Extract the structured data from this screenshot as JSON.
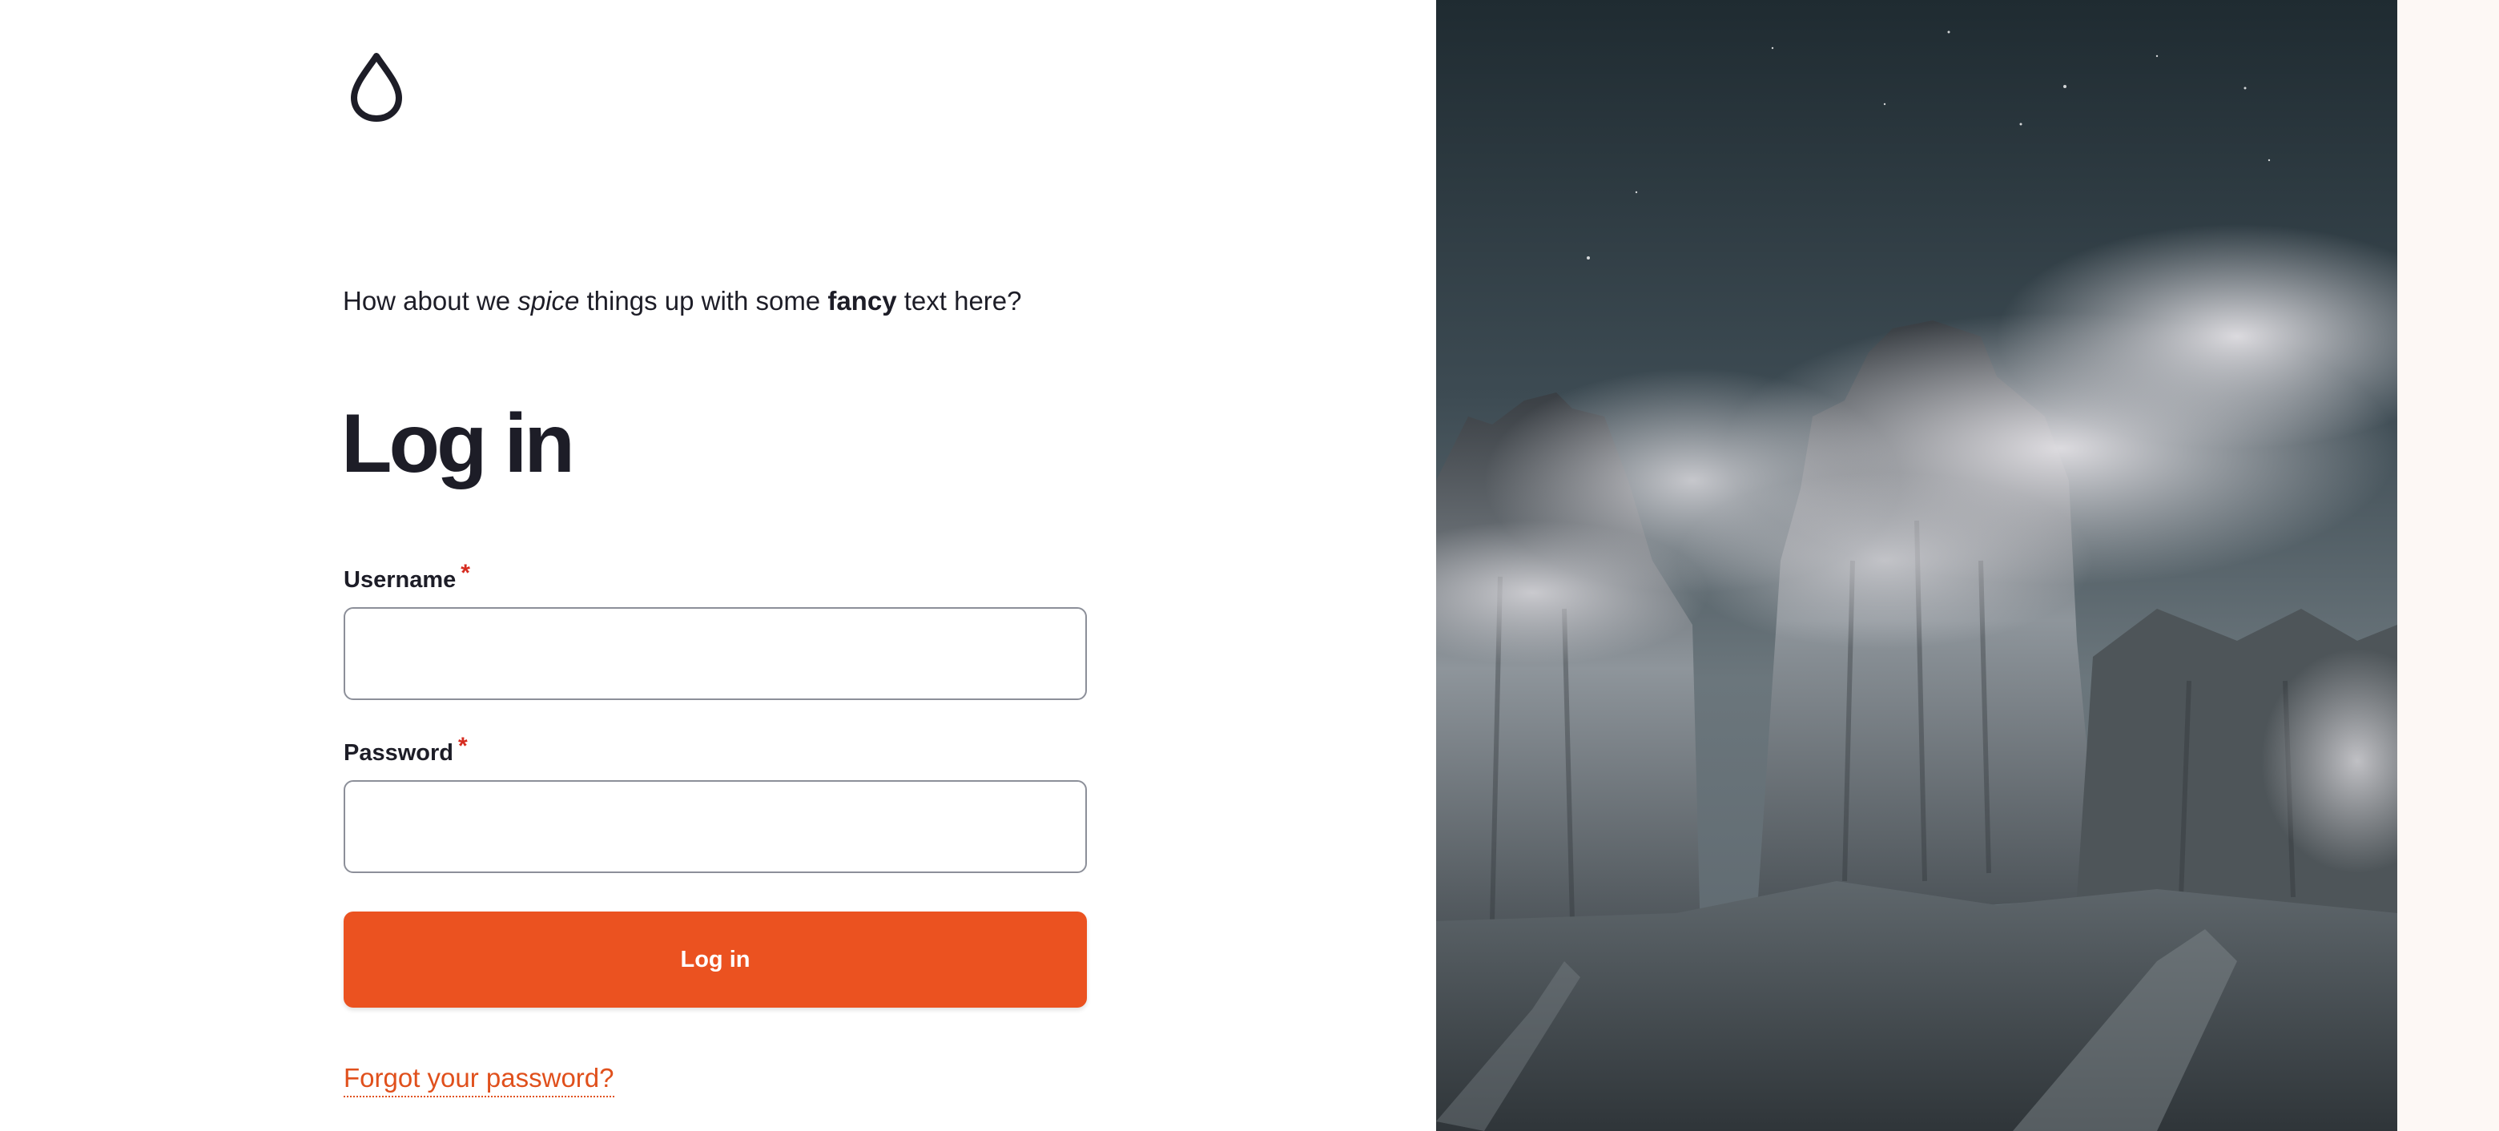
{
  "brand": {
    "logo_icon": "droplet-icon",
    "accent_color": "#eb5220"
  },
  "tagline": {
    "part1": "How about we ",
    "italic": "spice",
    "part2": " things up with some ",
    "bold": "fancy",
    "part3": " text here?"
  },
  "form": {
    "title": "Log in",
    "username_label": "Username",
    "password_label": "Password",
    "required_marker": "*",
    "username_value": "",
    "password_value": "",
    "submit_label": "Log in",
    "forgot_password_label": "Forgot your password?"
  },
  "hero": {
    "image": "misty-mountain-peaks-photo"
  }
}
